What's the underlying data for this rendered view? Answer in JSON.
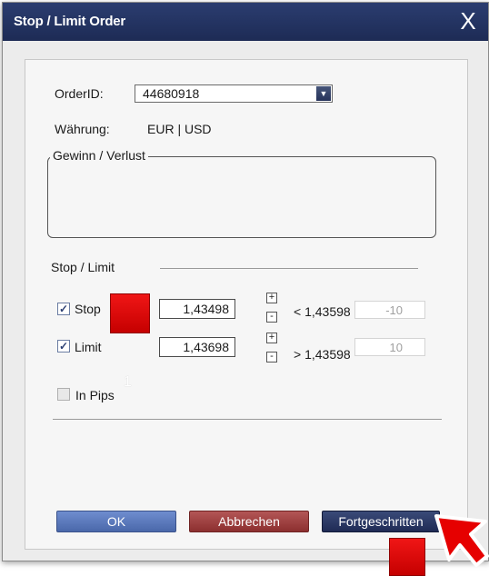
{
  "window": {
    "title": "Stop / Limit Order",
    "close_glyph": "X"
  },
  "order": {
    "label": "OrderID:",
    "value": "44680918",
    "dropdown_glyph": "▼"
  },
  "currency": {
    "label": "Währung:",
    "value": "EUR | USD"
  },
  "pnl": {
    "label": "Gewinn / Verlust"
  },
  "stop_limit_section": {
    "label": "Stop / Limit"
  },
  "stop": {
    "checked": true,
    "label": "Stop",
    "price": "1,43498",
    "plus": "+",
    "minus": "-",
    "condition": "< 1,43598",
    "pips": "-10"
  },
  "limit": {
    "checked": true,
    "label": "Limit",
    "price": "1,43698",
    "plus": "+",
    "minus": "-",
    "condition": "> 1,43598",
    "pips": "10"
  },
  "in_pips": {
    "checked": false,
    "label": "In Pips"
  },
  "step_marker": "1",
  "buttons": {
    "ok": "OK",
    "cancel": "Abbrechen",
    "advanced": "Fortgeschritten"
  },
  "colors": {
    "title_bar": "#1d2b55",
    "marker": "#e00000",
    "ok": "#5878bb",
    "cancel": "#a04444",
    "advanced": "#2a3866"
  },
  "icons": {
    "checkbox": "check-icon",
    "cursor": "arrow-cursor-icon"
  }
}
